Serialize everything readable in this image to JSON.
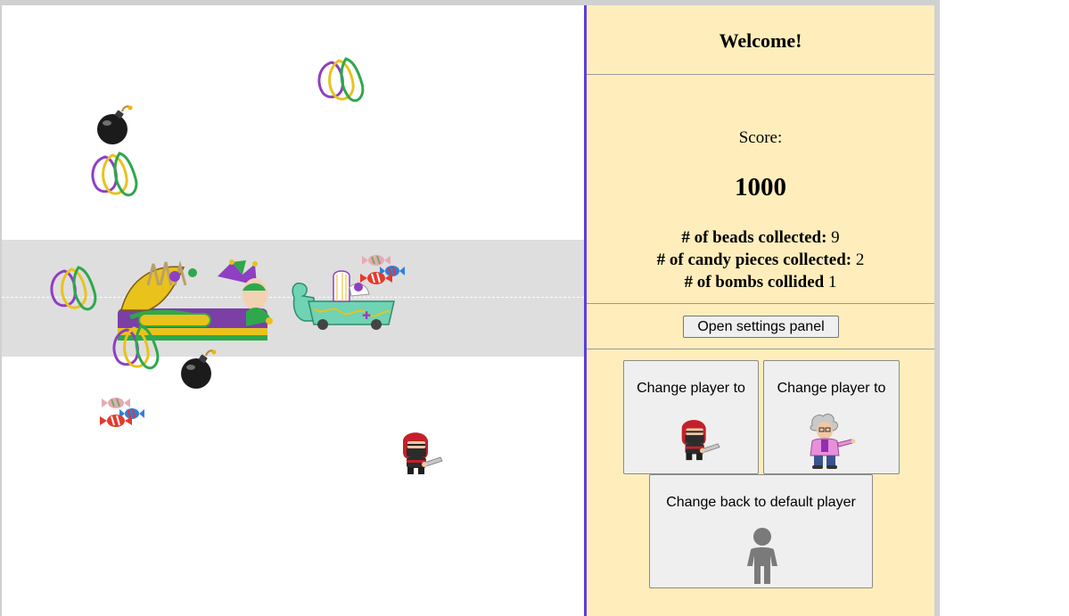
{
  "panel": {
    "welcome": "Welcome!",
    "score_label": "Score:",
    "score_value": "1000",
    "stats": {
      "beads_label": "# of beads collected:",
      "beads_value": "9",
      "candy_label": "# of candy pieces collected:",
      "candy_value": "2",
      "bombs_label": "# of bombs collided",
      "bombs_value": "1"
    },
    "settings_button": "Open settings panel",
    "player_buttons": {
      "ninja_label": "Change player to",
      "professor_label": "Change player to",
      "default_label": "Change back to default player"
    }
  },
  "game": {
    "objects": [
      "beads",
      "bomb",
      "beads",
      "beads",
      "mardi-gras-float",
      "parade-float",
      "candy",
      "beads",
      "bomb",
      "candy",
      "ninja-player"
    ]
  },
  "colors": {
    "panel_bg": "#ffeebb",
    "panel_border": "#5b3fe0",
    "street": "#dedede",
    "bead_purple": "#8e3fc2",
    "bead_gold": "#e9c21c",
    "bead_green": "#2ea84a"
  }
}
